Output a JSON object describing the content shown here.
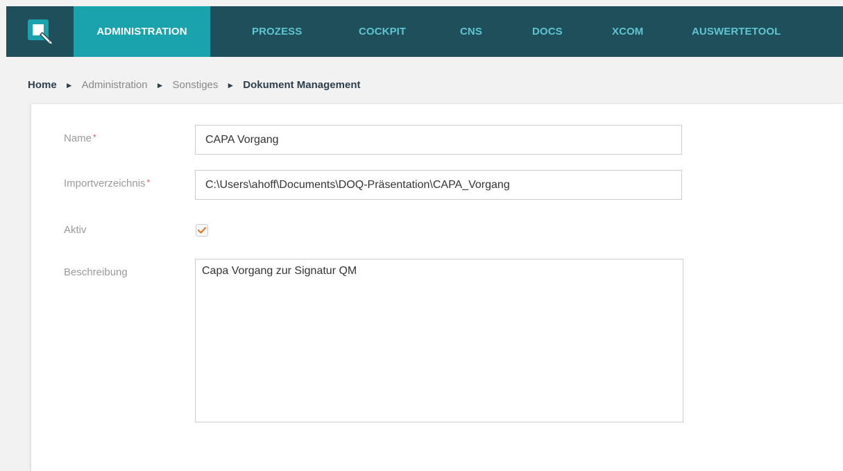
{
  "nav": {
    "items": [
      {
        "label": "ADMINISTRATION",
        "active": true
      },
      {
        "label": "PROZESS"
      },
      {
        "label": "COCKPIT"
      },
      {
        "label": "CNS"
      },
      {
        "label": "DOCS"
      },
      {
        "label": "XCOM"
      },
      {
        "label": "AUSWERTETOOL"
      }
    ]
  },
  "breadcrumb": {
    "home": "Home",
    "administration": "Administration",
    "sonstiges": "Sonstiges",
    "current": "Dokument Management",
    "separator": "►"
  },
  "form": {
    "required_marker": "*",
    "name": {
      "label": "Name",
      "value": "CAPA Vorgang"
    },
    "importverzeichnis": {
      "label": "Importverzeichnis",
      "value": "C:\\Users\\ahoff\\Documents\\DOQ-Präsentation\\CAPA_Vorgang"
    },
    "aktiv": {
      "label": "Aktiv",
      "checked": true
    },
    "beschreibung": {
      "label": "Beschreibung",
      "value": "Capa Vorgang zur Signatur QM"
    }
  },
  "colors": {
    "header_bg": "#1f4f5a",
    "active_tab": "#1aa3ad",
    "tab_text": "#5ec5d1",
    "check_mark": "#e0772a",
    "required": "#e05555"
  },
  "icons": {
    "logo": "doq-logo-icon",
    "checkbox": "check-icon"
  }
}
